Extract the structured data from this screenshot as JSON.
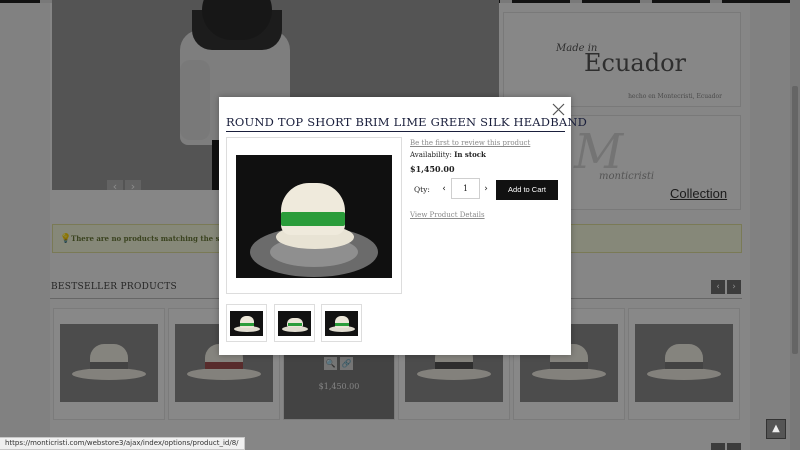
{
  "colors": {
    "modal_title": "#1a1f3c",
    "add_to_cart_bg": "#111111",
    "hat_band": "#2a9c3a",
    "link": "#8a8a8a",
    "notice_bg": "#f5f7dc"
  },
  "background_page": {
    "made_in": "Made in",
    "ecuador": "Ecuador",
    "made_in_sub": "hecho en Montecristi, Ecuador",
    "brand_logo": "monticristi",
    "collection_link": "Collection",
    "notice_icon": "lightbulb-icon",
    "notice_text": "There are no products matching the selection",
    "bestseller_heading": "BESTSELLER PRODUCTS",
    "hover_price": "$1,450.00",
    "hover_icons": [
      "zoom-icon",
      "link-icon"
    ],
    "prev_arrow": "‹",
    "next_arrow": "›"
  },
  "quick_view": {
    "title": "ROUND TOP SHORT BRIM LIME GREEN SILK HEADBAND",
    "review_link": "Be the first to review this product",
    "availability_label": "Availability:",
    "availability_value": "In stock",
    "price": "$1,450.00",
    "qty_label": "Qty:",
    "qty_value": "1",
    "qty_decrement": "‹",
    "qty_increment": "›",
    "add_to_cart": "Add to Cart",
    "view_details": "View Product Details",
    "thumbnail_count": 3
  },
  "scroll_top_icon": "▲",
  "status_bar_url": "https://monticristi.com/webstore3/ajax/index/options/product_id/8/"
}
